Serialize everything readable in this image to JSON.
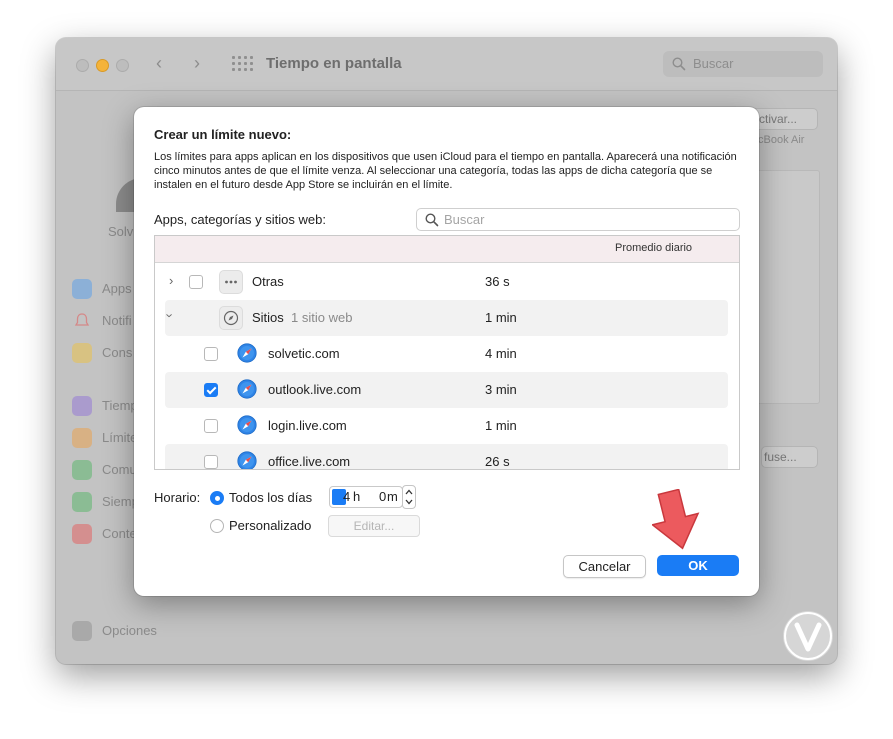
{
  "window": {
    "title": "Tiempo en pantalla",
    "search_placeholder": "Buscar",
    "bg_button_label": "ctivar...",
    "bg_device_label": "cBook Air",
    "bg_user_label": "Solv",
    "bg_hidden_button": "fuse..."
  },
  "sidebar": {
    "items": [
      {
        "label": "Apps",
        "icon": "app-usage-icon",
        "color": "#4a9af0"
      },
      {
        "label": "Notifi",
        "icon": "notifications-icon",
        "color": "#e85d5d"
      },
      {
        "label": "Cons",
        "icon": "pickups-icon",
        "color": "#f1c232"
      },
      {
        "label": "Tiemp",
        "icon": "downtime-icon",
        "color": "#8c6bd9"
      },
      {
        "label": "Límite",
        "icon": "app-limits-icon",
        "color": "#f29b38"
      },
      {
        "label": "Comu",
        "icon": "communication-icon",
        "color": "#46b35b"
      },
      {
        "label": "Siemp",
        "icon": "always-allowed-icon",
        "color": "#46b35b"
      },
      {
        "label": "Conte",
        "icon": "content-privacy-icon",
        "color": "#e85050"
      }
    ],
    "options_label": "Opciones"
  },
  "sheet": {
    "title": "Crear un límite nuevo:",
    "description": "Los límites para apps aplican en los dispositivos que usen iCloud para el tiempo en pantalla. Aparecerá una notificación cinco minutos antes de que el límite venza. Al seleccionar una categoría, todas las apps de dicha categoría que se instalen en el futuro desde App Store se incluirán en el límite.",
    "apps_label": "Apps, categorías y sitios web:",
    "search_placeholder": "Buscar",
    "table": {
      "column_header": "Promedio diario",
      "rows": [
        {
          "name": "Otras",
          "sub": "",
          "value": "36 s",
          "checked": false,
          "icon": "more-icon"
        },
        {
          "name": "Sitios",
          "sub": "1 sitio web",
          "value": "1 min",
          "icon": "compass-icon"
        },
        {
          "name": "solvetic.com",
          "value": "4 min",
          "checked": false,
          "icon": "safari-icon"
        },
        {
          "name": "outlook.live.com",
          "value": "3 min",
          "checked": true,
          "icon": "safari-icon"
        },
        {
          "name": "login.live.com",
          "value": "1 min",
          "checked": false,
          "icon": "safari-icon"
        },
        {
          "name": "office.live.com",
          "value": "26 s",
          "checked": false,
          "icon": "safari-icon"
        }
      ]
    },
    "schedule": {
      "label": "Horario:",
      "option_every_day": "Todos los días",
      "option_custom": "Personalizado",
      "hours": "4",
      "hours_unit": "h",
      "minutes": "0",
      "minutes_unit": "m",
      "edit_label": "Editar..."
    },
    "cancel_label": "Cancelar",
    "ok_label": "OK"
  },
  "colors": {
    "accent": "#1a7cf5",
    "arrow": "#ec5a5e"
  }
}
